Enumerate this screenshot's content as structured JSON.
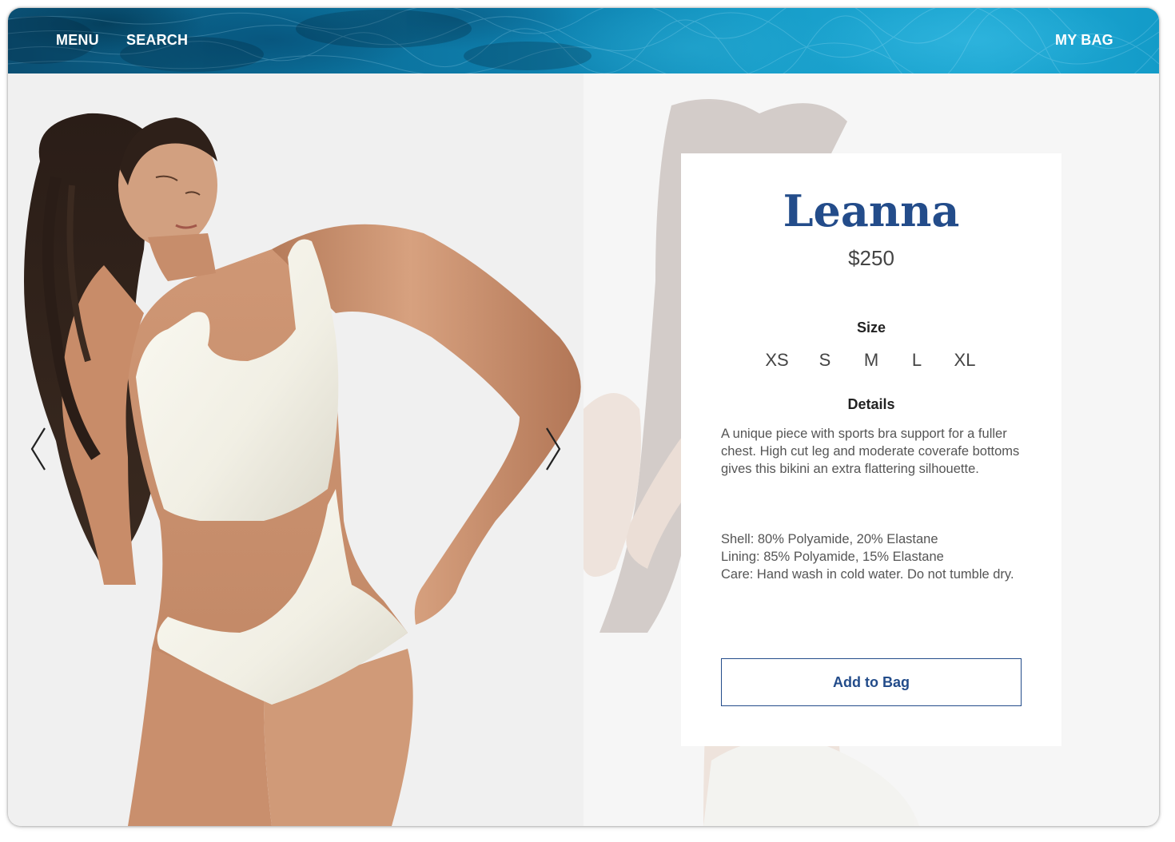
{
  "header": {
    "menu_label": "MENU",
    "search_label": "SEARCH",
    "bag_label": "MY BAG"
  },
  "gallery": {
    "prev_icon": "chevron-left-icon",
    "next_icon": "chevron-right-icon"
  },
  "product": {
    "name": "Leanna",
    "price": "$250",
    "size_label": "Size",
    "sizes": [
      "XS",
      "S",
      "M",
      "L",
      "XL"
    ],
    "details_label": "Details",
    "description": "A unique piece with sports bra support for a fuller chest. High cut leg and moderate coverafe bottoms gives this bikini an extra flattering silhouette.",
    "specs": [
      "Shell: 80% Polyamide, 20% Elastane",
      "Lining: 85% Polyamide, 15% Elastane",
      "Care: Hand wash in cold water. Do not tumble dry."
    ],
    "add_button": "Add to Bag"
  },
  "colors": {
    "brand_blue": "#234c8a",
    "header_water": "#1ea8d3"
  }
}
